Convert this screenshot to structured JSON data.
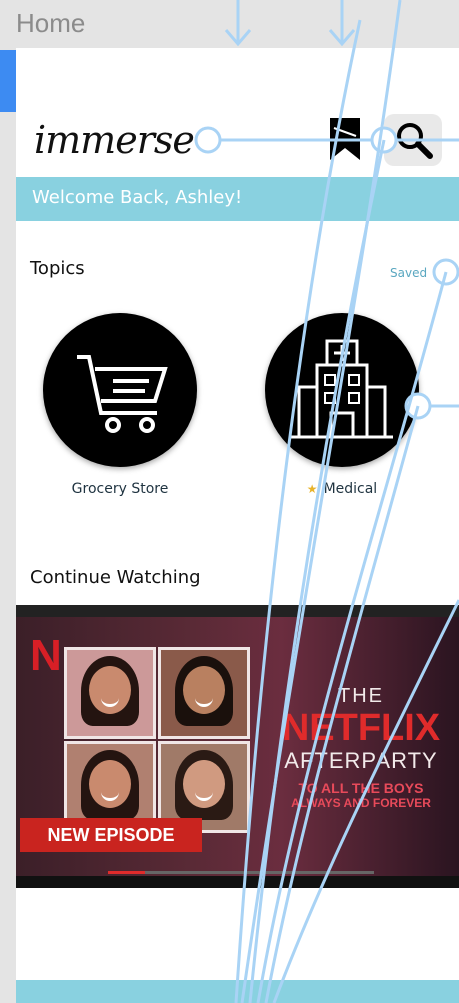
{
  "frame": {
    "label": "Home"
  },
  "app": {
    "logo_text": "immerse"
  },
  "header": {
    "icons": [
      "bookmark-icon",
      "search-icon"
    ]
  },
  "welcome": {
    "text": "Welcome Back, Ashley!"
  },
  "topics": {
    "title": "Topics",
    "saved_label": "Saved",
    "items": [
      {
        "label": "Grocery Store",
        "icon": "shopping-cart-icon",
        "starred": false
      },
      {
        "label": "Medical",
        "icon": "hospital-icon",
        "starred": true
      }
    ]
  },
  "continue_watching": {
    "title": "Continue Watching",
    "video": {
      "brand_mark": "N",
      "badge": "NEW EPISODE",
      "title_line1": "THE",
      "title_line2": "NETFLIX",
      "title_line3": "AFTERPARTY",
      "subtitle_line1": "TO ALL THE BOYS",
      "subtitle_line2": "ALWAYS AND FOREVER",
      "progress": 0.14
    }
  },
  "colors": {
    "accent": "#89d1e0",
    "frame_indicator": "#3d8bf2",
    "prototype_link": "#a9d3f5"
  }
}
